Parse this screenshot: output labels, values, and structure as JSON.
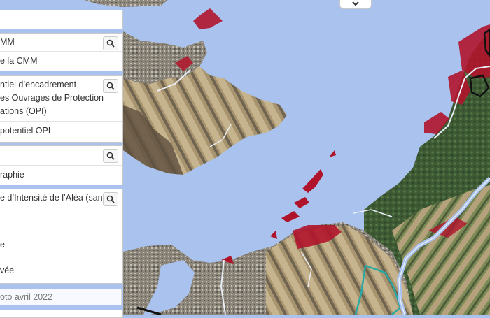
{
  "map": {
    "colors": {
      "water": "#a9c2ee",
      "land_dark": "#3f5a35",
      "land_field": "#b9a683",
      "urban": "#8a8377",
      "flood_zone": "#b0142b",
      "boundary_line": "#e9eef7",
      "teal_line": "#2aa8a4",
      "black_outline": "#111111"
    },
    "collapse_toggle_icon": "chevron-down-icon"
  },
  "panels": [
    {
      "id": "cmm",
      "lines": [
        "MM",
        "e la CMM"
      ],
      "icon": "search-icon"
    },
    {
      "id": "opi",
      "lines": [
        "ntiel d’encadrement",
        "es Ouvrages de Protection",
        "ations (OPI)",
        "potentiel OPI"
      ],
      "icon": "search-icon"
    },
    {
      "id": "topo",
      "lines": [
        "raphie"
      ],
      "icon": "search-icon"
    },
    {
      "id": "alea",
      "lines": [
        "e d’Intensité de l’Aléa (sans",
        "e",
        "vée"
      ],
      "icon": "search-icon"
    }
  ],
  "photo_label": "oto avril 2022"
}
